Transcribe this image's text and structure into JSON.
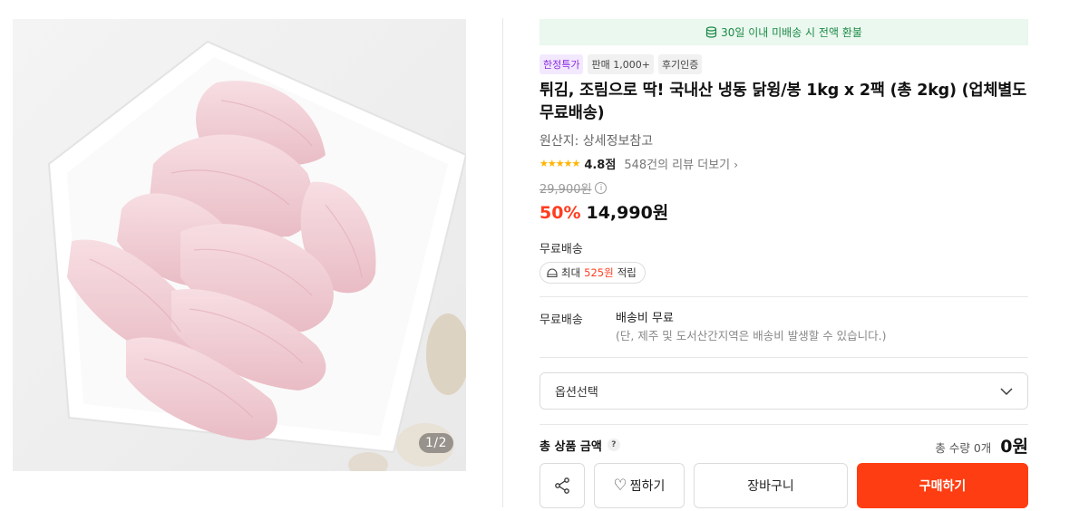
{
  "gallery": {
    "pager": "1/2"
  },
  "notice": {
    "refund_text": "30일 이내 미배송 시 전액 환불",
    "icon": "coin-stack-icon"
  },
  "badges": [
    "한정특가",
    "판매 1,000+",
    "후기인증"
  ],
  "product": {
    "title": "튀김, 조림으로 딱! 국내산 냉동 닭윙/봉 1kg x 2팩 (총 2kg) (업체별도 무료배송)",
    "origin": "원산지: 상세정보참고",
    "stars": "★★★★★",
    "rating": "4.8점",
    "review_link": "548건의 리뷰 더보기",
    "review_chevron": "›",
    "original_price": "29,900원",
    "info_mark": "i",
    "discount": "50%",
    "price": "14,990원"
  },
  "shipping": {
    "label": "무료배송",
    "points_prefix": "최대",
    "points_amount": "525원",
    "points_suffix": "적립"
  },
  "delivery": {
    "label": "무료배송",
    "fee": "배송비 무료",
    "note": "(단, 제주 및 도서산간지역은 배송비 발생할 수 있습니다.)"
  },
  "options": {
    "placeholder": "옵션선택"
  },
  "total": {
    "label": "총 상품 금액",
    "help": "?",
    "quantity": "총 수량 0개",
    "amount": "0원"
  },
  "actions": {
    "wishlist": "찜하기",
    "cart": "장바구니",
    "buy": "구매하기"
  },
  "colors": {
    "accent": "#ff3d12",
    "refund_bg": "#eaf8ef",
    "refund_text": "#1d8a47",
    "promo": "#8a2be2"
  }
}
